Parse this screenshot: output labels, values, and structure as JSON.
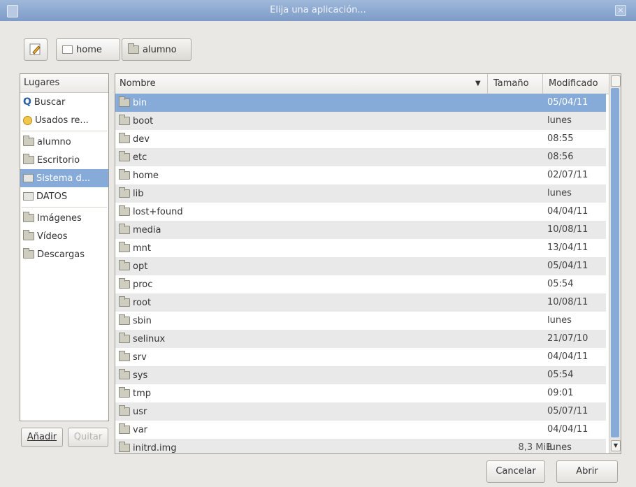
{
  "window": {
    "title": "Elija una aplicación...",
    "close_glyph": "×"
  },
  "pathbar": {
    "segments": [
      "home",
      "alumno"
    ]
  },
  "places": {
    "header": "Lugares",
    "items": [
      {
        "label": "Buscar",
        "icon": "search-icon"
      },
      {
        "label": "Usados re...",
        "icon": "recent-icon"
      },
      {
        "label": "alumno",
        "icon": "folder-icon"
      },
      {
        "label": "Escritorio",
        "icon": "folder-icon"
      },
      {
        "label": "Sistema d...",
        "icon": "drive-icon",
        "selected": true
      },
      {
        "label": "DATOS",
        "icon": "drive-icon"
      },
      {
        "label": "Imágenes",
        "icon": "folder-icon"
      },
      {
        "label": "Vídeos",
        "icon": "folder-icon"
      },
      {
        "label": "Descargas",
        "icon": "folder-icon"
      }
    ],
    "add_label": "Añadir",
    "remove_label": "Quitar"
  },
  "files": {
    "columns": {
      "name": "Nombre",
      "size": "Tamaño",
      "modified": "Modificado"
    },
    "rows": [
      {
        "name": "bin",
        "size": "",
        "modified": "05/04/11",
        "selected": true
      },
      {
        "name": "boot",
        "size": "",
        "modified": "lunes"
      },
      {
        "name": "dev",
        "size": "",
        "modified": "08:55"
      },
      {
        "name": "etc",
        "size": "",
        "modified": "08:56"
      },
      {
        "name": "home",
        "size": "",
        "modified": "02/07/11"
      },
      {
        "name": "lib",
        "size": "",
        "modified": "lunes"
      },
      {
        "name": "lost+found",
        "size": "",
        "modified": "04/04/11"
      },
      {
        "name": "media",
        "size": "",
        "modified": "10/08/11"
      },
      {
        "name": "mnt",
        "size": "",
        "modified": "13/04/11"
      },
      {
        "name": "opt",
        "size": "",
        "modified": "05/04/11"
      },
      {
        "name": "proc",
        "size": "",
        "modified": "05:54"
      },
      {
        "name": "root",
        "size": "",
        "modified": "10/08/11"
      },
      {
        "name": "sbin",
        "size": "",
        "modified": "lunes"
      },
      {
        "name": "selinux",
        "size": "",
        "modified": "21/07/10"
      },
      {
        "name": "srv",
        "size": "",
        "modified": "04/04/11"
      },
      {
        "name": "sys",
        "size": "",
        "modified": "05:54"
      },
      {
        "name": "tmp",
        "size": "",
        "modified": "09:01"
      },
      {
        "name": "usr",
        "size": "",
        "modified": "05/07/11"
      },
      {
        "name": "var",
        "size": "",
        "modified": "04/04/11"
      },
      {
        "name": "initrd.img",
        "size": "8,3 MiB",
        "modified": "lunes"
      }
    ]
  },
  "actions": {
    "cancel_label": "Cancelar",
    "open_label": "Abrir"
  },
  "colors": {
    "selection": "#86abd9",
    "titlebar": "#8aa7cf"
  }
}
